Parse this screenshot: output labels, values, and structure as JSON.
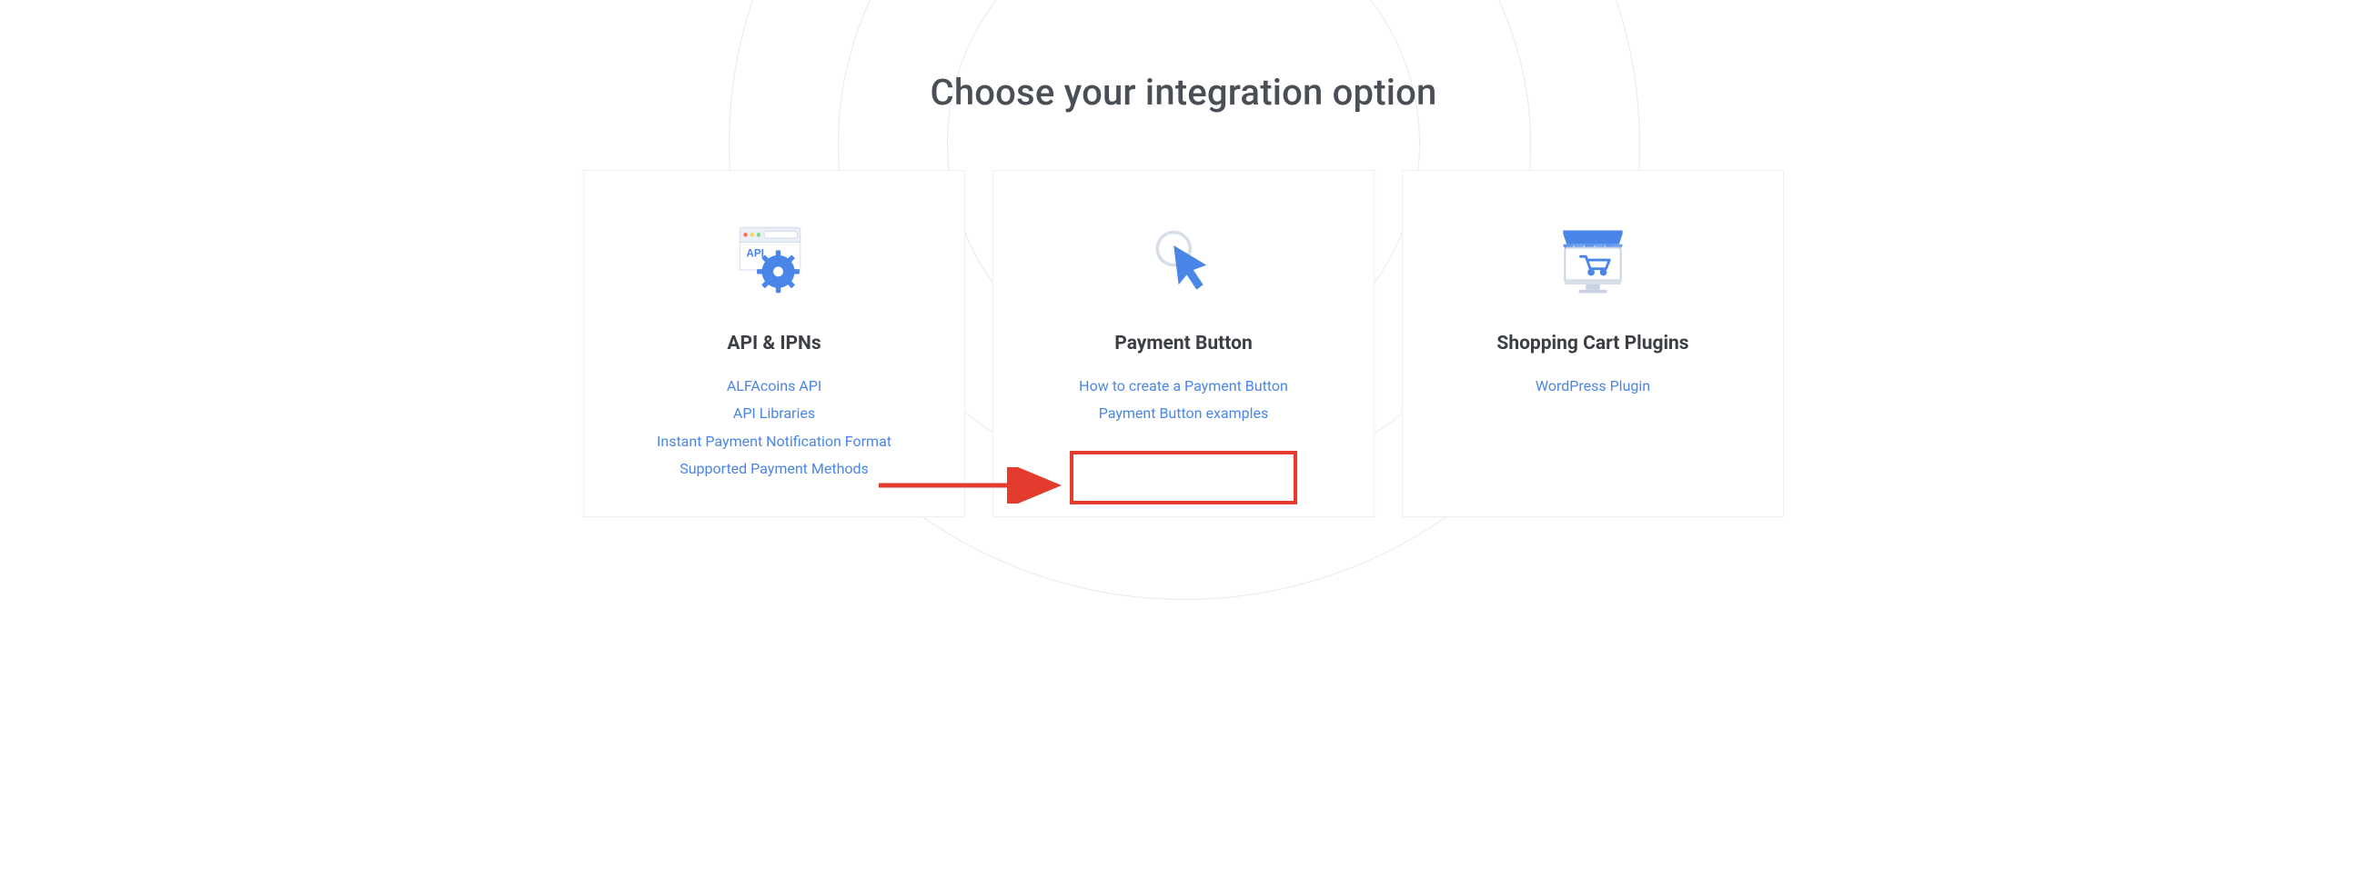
{
  "heading": "Choose your integration option",
  "cards": {
    "api": {
      "title": "API & IPNs",
      "links": [
        "ALFAcoins API",
        "API Libraries",
        "Instant Payment Notification Format",
        "Supported Payment Methods"
      ]
    },
    "button": {
      "title": "Payment Button",
      "links": [
        "How to create a Payment Button",
        "Payment Button examples"
      ]
    },
    "cart": {
      "title": "Shopping Cart Plugins",
      "links": [
        "WordPress Plugin"
      ]
    }
  },
  "annotation": {
    "highlight_target": "Payment Button examples"
  },
  "colors": {
    "link": "#4a86e8",
    "heading": "#4a4f55",
    "annotation": "#e33b2e"
  }
}
